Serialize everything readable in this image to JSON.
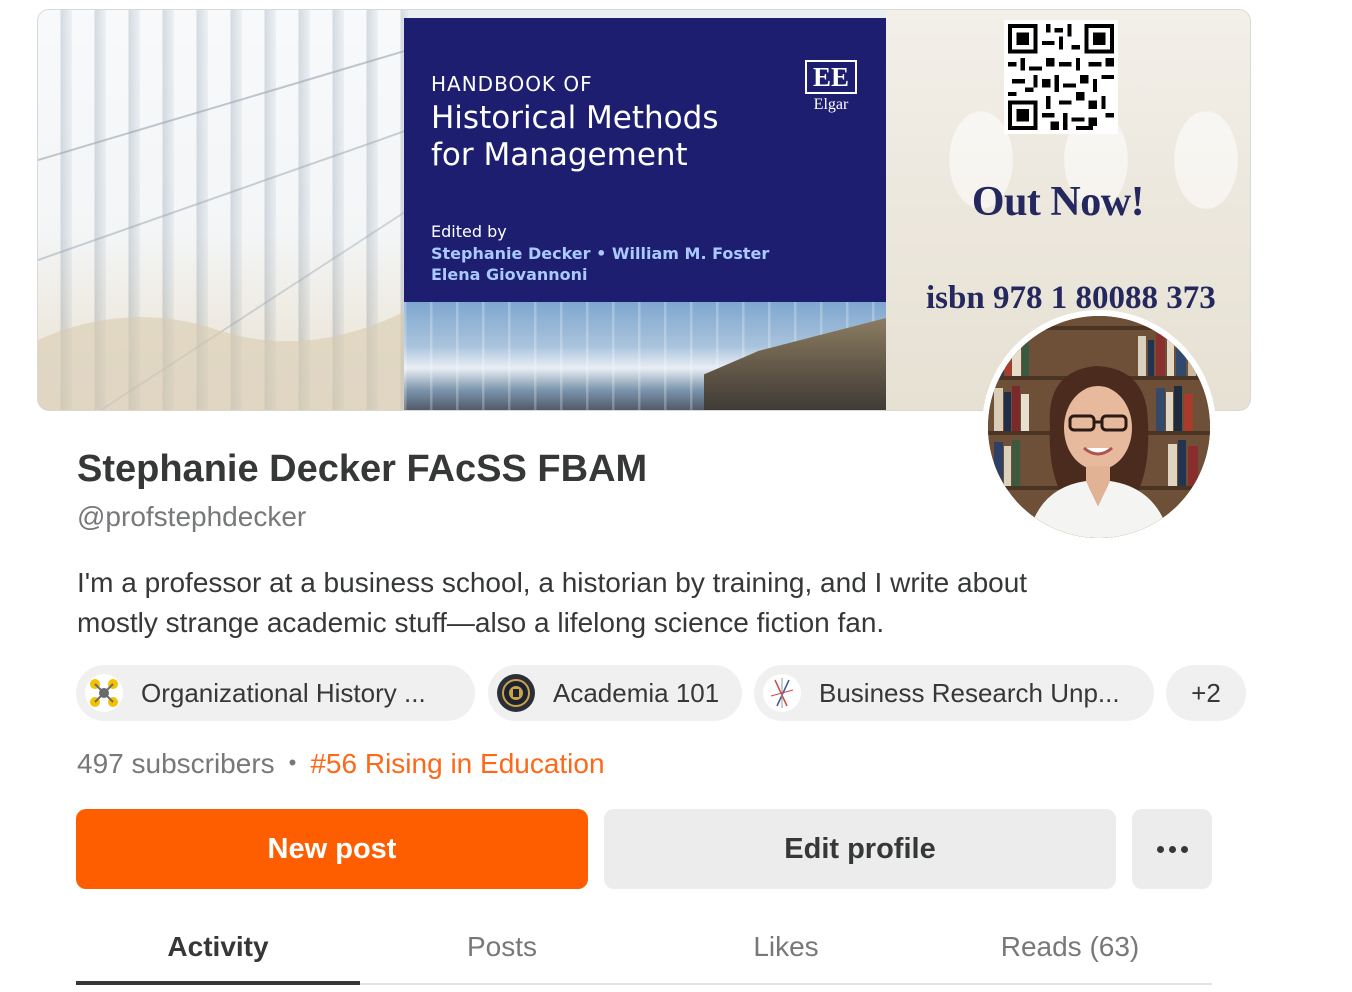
{
  "banner": {
    "book": {
      "series": "HANDBOOK OF",
      "title_line1": "Historical Methods",
      "title_line2": "for Management",
      "edited_by": "Edited by",
      "editors_line1": "Stephanie Decker • William M. Foster",
      "editors_line2": "Elena Giovannoni",
      "publisher_logo": "EE",
      "publisher_name": "Elgar"
    },
    "out_now": "Out Now!",
    "isbn": "isbn 978 1 80088 373"
  },
  "profile": {
    "name": "Stephanie Decker FAcSS FBAM",
    "handle": "@profstephdecker",
    "bio_line1": "I'm a professor at a business school, a historian by training, and I write about",
    "bio_line2": "mostly strange academic stuff—also a lifelong science fiction fan."
  },
  "publications": [
    {
      "label": "Organizational History ...",
      "icon": "network-logo-icon"
    },
    {
      "label": "Academia 101",
      "icon": "seal-logo-icon"
    },
    {
      "label": "Business Research Unp...",
      "icon": "lines-logo-icon"
    }
  ],
  "publications_more": "+2",
  "stats": {
    "subscribers": "497 subscribers",
    "separator": "•",
    "rank": "#56 Rising in Education"
  },
  "actions": {
    "new_post": "New post",
    "edit_profile": "Edit profile",
    "more_icon": "ellipsis-icon"
  },
  "tabs": [
    {
      "label": "Activity",
      "active": true
    },
    {
      "label": "Posts",
      "active": false
    },
    {
      "label": "Likes",
      "active": false
    },
    {
      "label": "Reads (63)",
      "active": false
    }
  ],
  "colors": {
    "accent": "#ff5e00",
    "rank": "#ff6719",
    "book_cover": "#1e1e71",
    "editors_text": "#a9c9ff",
    "out_now_text": "#25285e"
  }
}
